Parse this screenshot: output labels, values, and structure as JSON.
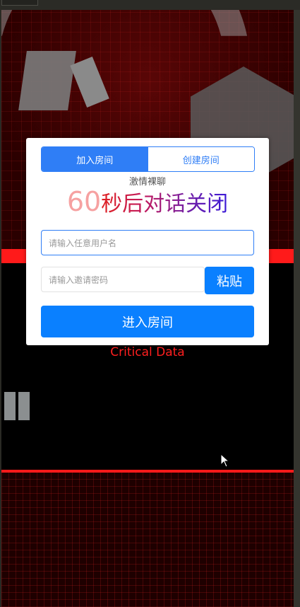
{
  "modal": {
    "tabs": [
      {
        "label": "加入房间",
        "active": true
      },
      {
        "label": "创建房间",
        "active": false
      }
    ],
    "subtitle": "激情裸聊",
    "countdown_number": "60",
    "countdown_text": "秒后对话关闭",
    "username_placeholder": "请输入任意用户名",
    "password_placeholder": "请输入邀请密码",
    "paste_label": "粘贴",
    "enter_label": "进入房间"
  },
  "background": {
    "caption": "Critical Data"
  },
  "colors": {
    "accent": "#2f7ef6",
    "button": "#0a80ff",
    "countdown_number": "#f6a1a1",
    "caption": "#ff1f1f",
    "red_bar": "#ff1a1a"
  }
}
